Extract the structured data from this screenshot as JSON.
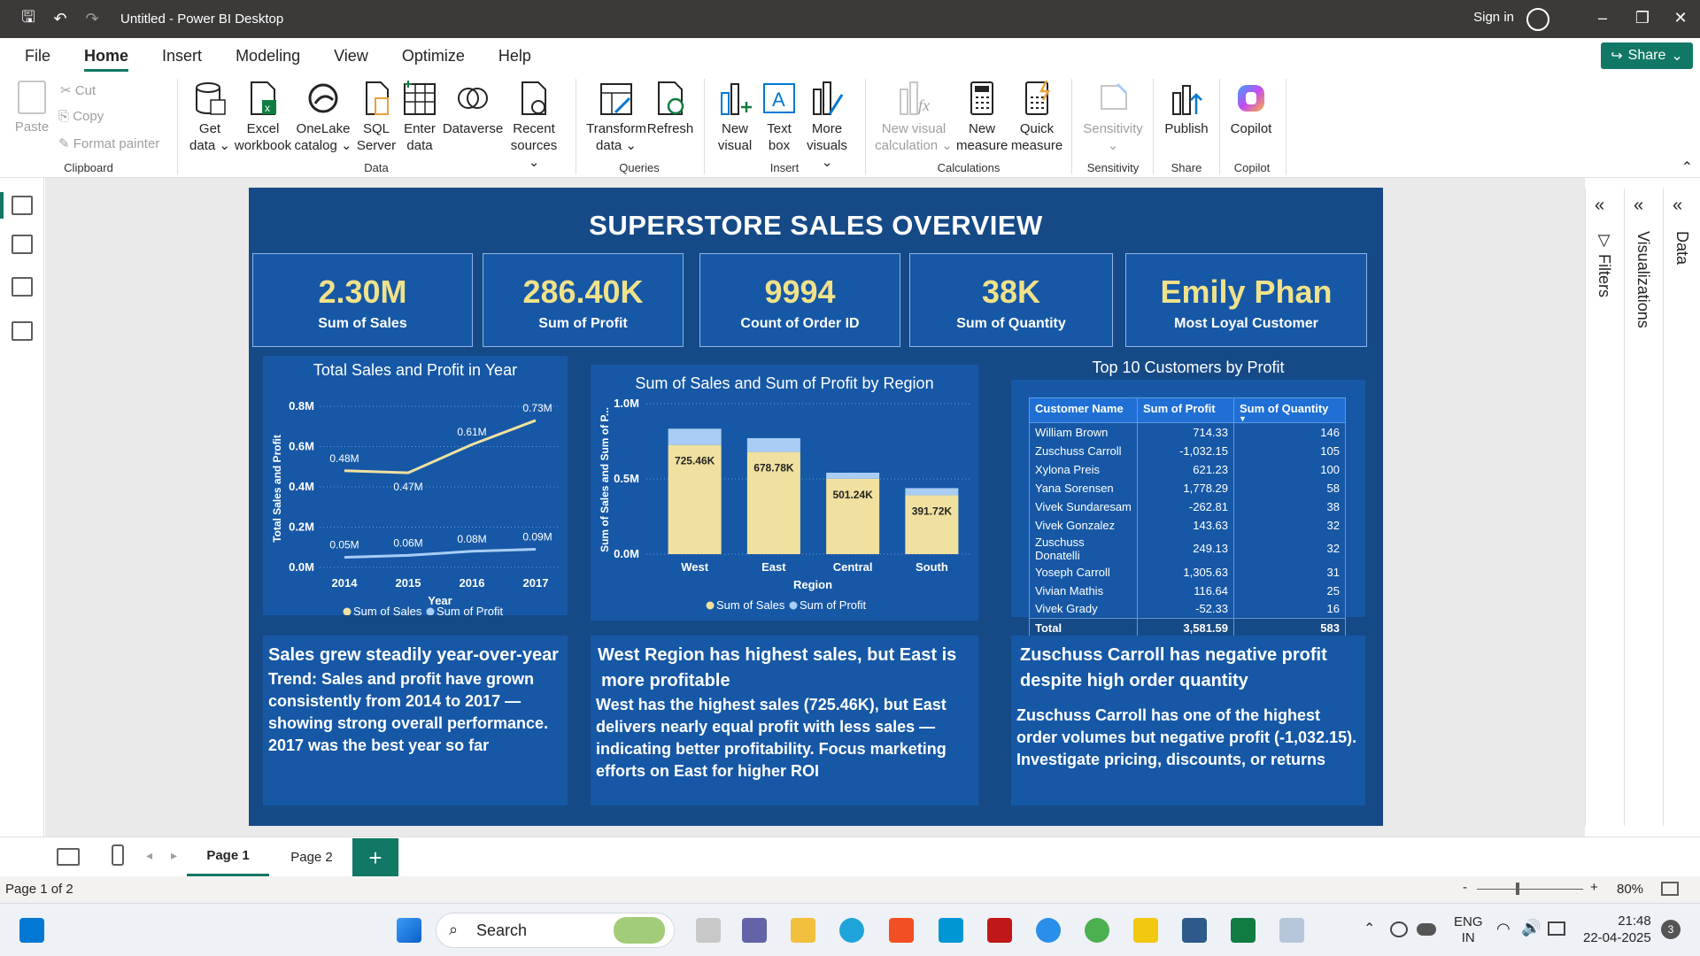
{
  "window": {
    "title": "Untitled - Power BI Desktop",
    "signin": "Sign in"
  },
  "menu": {
    "items": [
      "File",
      "Home",
      "Insert",
      "Modeling",
      "View",
      "Optimize",
      "Help"
    ],
    "active": "Home",
    "share": "Share"
  },
  "ribbon": {
    "clipboard": {
      "paste": "Paste",
      "cut": "Cut",
      "copy": "Copy",
      "format_painter": "Format painter",
      "label": "Clipboard"
    },
    "data": {
      "get_data": [
        "Get",
        "data"
      ],
      "excel": [
        "Excel",
        "workbook"
      ],
      "onelake": [
        "OneLake",
        "catalog"
      ],
      "sql": [
        "SQL",
        "Server"
      ],
      "enter": [
        "Enter",
        "data"
      ],
      "dataverse": [
        "Dataverse",
        ""
      ],
      "recent": [
        "Recent",
        "sources"
      ],
      "label": "Data"
    },
    "queries": {
      "transform": [
        "Transform",
        "data"
      ],
      "refresh": [
        "Refresh",
        ""
      ],
      "label": "Queries"
    },
    "insert": {
      "new_visual": [
        "New",
        "visual"
      ],
      "text_box": [
        "Text",
        "box"
      ],
      "more_visuals": [
        "More",
        "visuals"
      ],
      "label": "Insert"
    },
    "calculations": {
      "new_visual_calc": [
        "New visual",
        "calculation"
      ],
      "new_measure": [
        "New",
        "measure"
      ],
      "quick_measure": [
        "Quick",
        "measure"
      ],
      "label": "Calculations"
    },
    "sensitivity": {
      "btn": "Sensitivity",
      "label": "Sensitivity"
    },
    "share": {
      "publish": "Publish",
      "label": "Share"
    },
    "copilot": {
      "btn": "Copilot",
      "label": "Copilot"
    }
  },
  "report": {
    "title": "SUPERSTORE SALES OVERVIEW",
    "kpis": [
      {
        "value": "2.30M",
        "label": "Sum of Sales"
      },
      {
        "value": "286.40K",
        "label": "Sum of Profit"
      },
      {
        "value": "9994",
        "label": "Count of Order ID"
      },
      {
        "value": "38K",
        "label": "Sum of Quantity"
      },
      {
        "value": "Emily Phan",
        "label": "Most Loyal Customer"
      }
    ],
    "line_title": "Total Sales and Profit in Year",
    "bar_title": "Sum of Sales and Sum of Profit by Region",
    "table_title": "Top 10 Customers by Profit",
    "table": {
      "headers": [
        "Customer Name",
        "Sum of Profit",
        "Sum of Quantity"
      ],
      "rows": [
        [
          "William Brown",
          "714.33",
          "146"
        ],
        [
          "Zuschuss Carroll",
          "-1,032.15",
          "105"
        ],
        [
          "Xylona Preis",
          "621.23",
          "100"
        ],
        [
          "Yana Sorensen",
          "1,778.29",
          "58"
        ],
        [
          "Vivek Sundaresam",
          "-262.81",
          "38"
        ],
        [
          "Vivek Gonzalez",
          "143.63",
          "32"
        ],
        [
          "Zuschuss Donatelli",
          "249.13",
          "32"
        ],
        [
          "Yoseph Carroll",
          "1,305.63",
          "31"
        ],
        [
          "Vivian Mathis",
          "116.64",
          "25"
        ],
        [
          "Vivek Grady",
          "-52.33",
          "16"
        ]
      ],
      "total": [
        "Total",
        "3,581.59",
        "583"
      ]
    },
    "insights": [
      {
        "title": "Sales grew steadily year-over-year",
        "body": "Trend: Sales and profit have grown consistently from 2014 to 2017 — showing strong overall performance. 2017 was the best year so far"
      },
      {
        "title": "West Region has highest sales, but East is more profitable",
        "body": "West has the highest sales (725.46K), but East delivers nearly equal profit with less sales — indicating better profitability. Focus marketing efforts on East for higher ROI"
      },
      {
        "title": "Zuschuss Carroll has negative profit despite high order quantity",
        "body": "Zuschuss Carroll has one of the highest order volumes but negative profit (-1,032.15). Investigate pricing, discounts, or returns"
      }
    ]
  },
  "chart_data": [
    {
      "type": "line",
      "title": "Total Sales and Profit in Year",
      "xlabel": "Year",
      "ylabel": "Total Sales and Profit",
      "x": [
        "2014",
        "2015",
        "2016",
        "2017"
      ],
      "ylim": [
        0,
        0.8
      ],
      "yticks": [
        "0.0M",
        "0.2M",
        "0.4M",
        "0.6M",
        "0.8M"
      ],
      "series": [
        {
          "name": "Sum of Sales",
          "values": [
            0.48,
            0.47,
            0.61,
            0.73
          ],
          "labels": [
            "0.48M",
            "0.47M",
            "0.61M",
            "0.73M"
          ],
          "color": "#f0e1a0"
        },
        {
          "name": "Sum of Profit",
          "values": [
            0.05,
            0.06,
            0.08,
            0.09
          ],
          "labels": [
            "0.05M",
            "0.06M",
            "0.08M",
            "0.09M"
          ],
          "color": "#a9cdf5"
        }
      ],
      "grid": true,
      "legend": "bottom"
    },
    {
      "type": "bar",
      "title": "Sum of Sales and Sum of Profit by Region",
      "xlabel": "Region",
      "ylabel": "Sum of Sales and Sum of P...",
      "categories": [
        "West",
        "East",
        "Central",
        "South"
      ],
      "ylim": [
        0,
        1.0
      ],
      "yticks": [
        "0.0M",
        "0.5M",
        "1.0M"
      ],
      "series": [
        {
          "name": "Sum of Sales",
          "values": [
            0.72546,
            0.67878,
            0.50124,
            0.39172
          ],
          "labels": [
            "725.46K",
            "678.78K",
            "501.24K",
            "391.72K"
          ],
          "color": "#f0e1a0"
        },
        {
          "name": "Sum of Profit",
          "values": [
            0.108,
            0.092,
            0.04,
            0.047
          ],
          "color": "#a9cdf5"
        }
      ],
      "stacked": true,
      "grid": true,
      "legend": "bottom"
    }
  ],
  "pages": {
    "tabs": [
      "Page 1",
      "Page 2"
    ],
    "active": "Page 1",
    "add": "+",
    "status": "Page 1 of 2"
  },
  "zoom": {
    "minus": "-",
    "plus": "+",
    "value": "80%"
  },
  "sidepanes": {
    "filters": "Filters",
    "visualizations": "Visualizations",
    "data": "Data"
  },
  "taskbar": {
    "search": "Search",
    "lang1": "ENG",
    "lang2": "IN",
    "time": "21:48",
    "date": "22-04-2025",
    "badge": "3"
  }
}
